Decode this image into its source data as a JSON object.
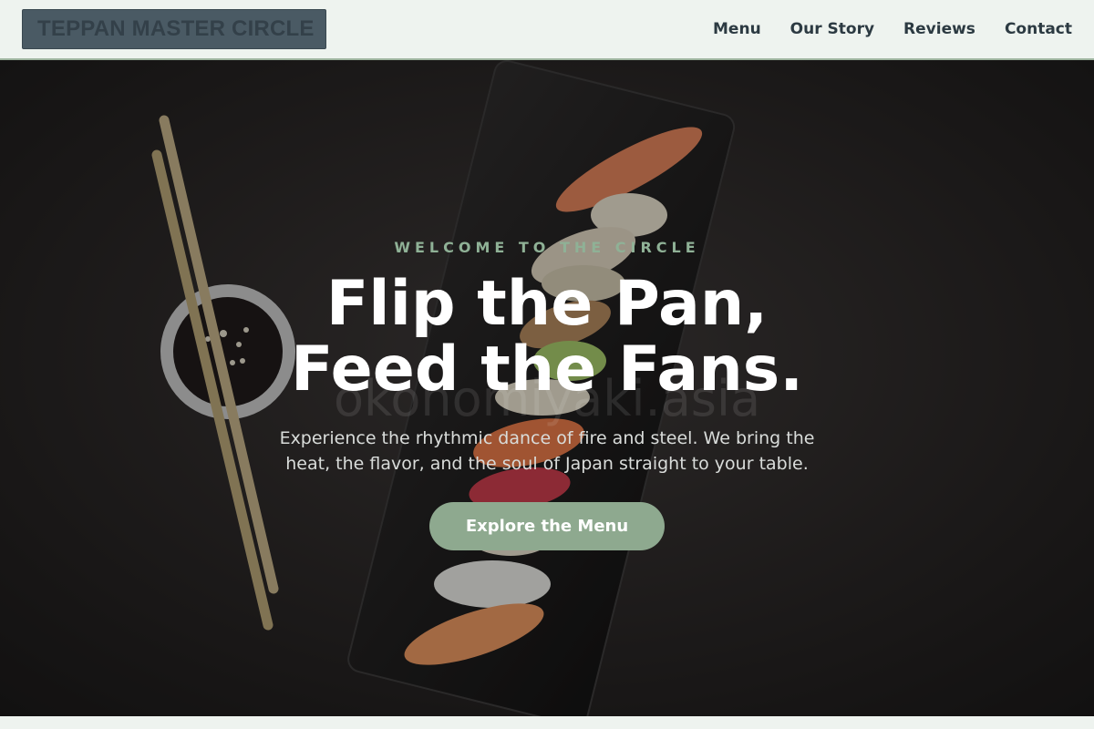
{
  "header": {
    "logo": "TEPPAN MASTER CIRCLE",
    "nav": [
      {
        "label": "Menu"
      },
      {
        "label": "Our Story"
      },
      {
        "label": "Reviews"
      },
      {
        "label": "Contact"
      }
    ]
  },
  "hero": {
    "eyebrow": "WELCOME TO THE CIRCLE",
    "headline_line1": "Flip the Pan,",
    "headline_line2": "Feed the Fans.",
    "subtext": "Experience the rhythmic dance of fire and steel. We bring the heat, the flavor, and the soul of Japan straight to your table.",
    "cta_label": "Explore the Menu",
    "watermark": "okonomiyaki.asia"
  },
  "colors": {
    "header_bg": "#eef3ef",
    "accent_green": "#8ea98f",
    "eyebrow_green": "#8fb196",
    "dark_bg": "#1a1818",
    "logo_box": "#4a5a64"
  }
}
